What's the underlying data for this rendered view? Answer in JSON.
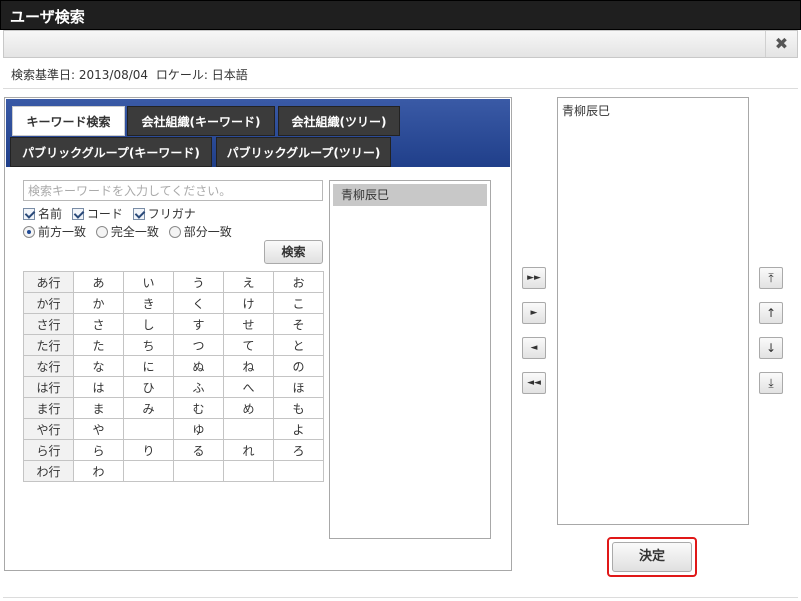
{
  "window": {
    "title": "ユーザ検索",
    "close_glyph": "✖"
  },
  "info": {
    "base_date_label": "検索基準日: 2013/08/04",
    "locale_label": "ロケール: 日本語"
  },
  "tabs": [
    {
      "label": "キーワード検索",
      "active": true
    },
    {
      "label": "会社組織(キーワード)"
    },
    {
      "label": "会社組織(ツリー)"
    },
    {
      "label": "パブリックグループ(キーワード)"
    },
    {
      "label": "パブリックグループ(ツリー)"
    }
  ],
  "search": {
    "placeholder": "検索キーワードを入力してください。",
    "value": "",
    "targets": [
      {
        "label": "名前",
        "checked": true
      },
      {
        "label": "コード",
        "checked": true
      },
      {
        "label": "フリガナ",
        "checked": true
      }
    ],
    "match_modes": [
      {
        "label": "前方一致",
        "checked": true
      },
      {
        "label": "完全一致",
        "checked": false
      },
      {
        "label": "部分一致",
        "checked": false
      }
    ],
    "button_label": "検索"
  },
  "kana_rows": [
    [
      "あ行",
      "あ",
      "い",
      "う",
      "え",
      "お"
    ],
    [
      "か行",
      "か",
      "き",
      "く",
      "け",
      "こ"
    ],
    [
      "さ行",
      "さ",
      "し",
      "す",
      "せ",
      "そ"
    ],
    [
      "た行",
      "た",
      "ち",
      "つ",
      "て",
      "と"
    ],
    [
      "な行",
      "な",
      "に",
      "ぬ",
      "ね",
      "の"
    ],
    [
      "は行",
      "は",
      "ひ",
      "ふ",
      "へ",
      "ほ"
    ],
    [
      "ま行",
      "ま",
      "み",
      "む",
      "め",
      "も"
    ],
    [
      "や行",
      "や",
      "",
      "ゆ",
      "",
      "よ"
    ],
    [
      "ら行",
      "ら",
      "り",
      "る",
      "れ",
      "ろ"
    ],
    [
      "わ行",
      "わ",
      "",
      "",
      "",
      ""
    ]
  ],
  "results": [
    "青柳辰巳"
  ],
  "transfer_buttons": [
    {
      "name": "add-all",
      "glyph": "►►"
    },
    {
      "name": "add",
      "glyph": "►"
    },
    {
      "name": "remove",
      "glyph": "◄"
    },
    {
      "name": "remove-all",
      "glyph": "◄◄"
    }
  ],
  "order_buttons": [
    {
      "name": "move-top",
      "glyph": "⤒"
    },
    {
      "name": "move-up",
      "glyph": "↑"
    },
    {
      "name": "move-down",
      "glyph": "↓"
    },
    {
      "name": "move-bottom",
      "glyph": "⤓"
    }
  ],
  "selected": [
    "青柳辰巳"
  ],
  "confirm_label": "決定",
  "colors": {
    "tab_bar": "#2c4c98",
    "highlight_border": "#e01818",
    "result_selected": "#c8c8c8"
  }
}
